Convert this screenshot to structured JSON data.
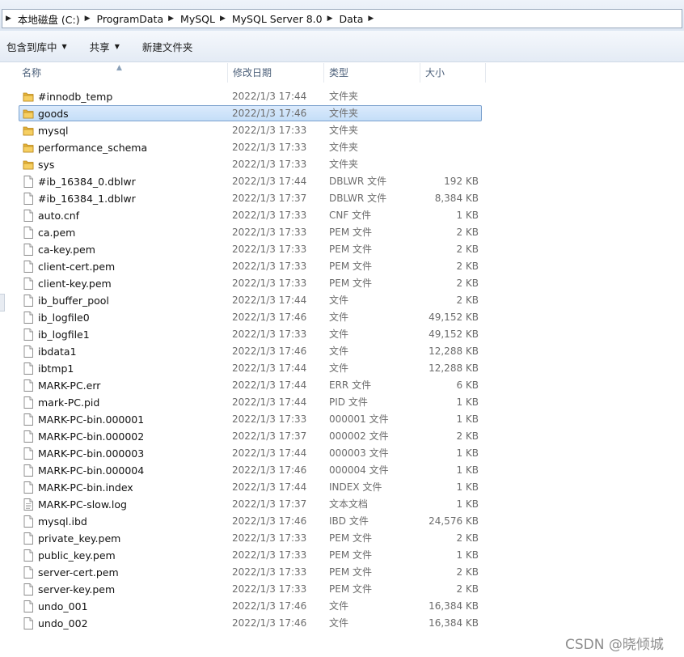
{
  "breadcrumb": [
    "本地磁盘 (C:)",
    "ProgramData",
    "MySQL",
    "MySQL Server 8.0",
    "Data"
  ],
  "toolbar": {
    "include_library": "包含到库中",
    "share": "共享",
    "new_folder": "新建文件夹"
  },
  "columns": {
    "name": "名称",
    "modified": "修改日期",
    "type": "类型",
    "size": "大小"
  },
  "rows": [
    {
      "name": "#innodb_temp",
      "date": "2022/1/3 17:44",
      "type": "文件夹",
      "size": "",
      "icon": "folder-icon"
    },
    {
      "name": "goods",
      "date": "2022/1/3 17:46",
      "type": "文件夹",
      "size": "",
      "icon": "folder-icon",
      "selected": true
    },
    {
      "name": "mysql",
      "date": "2022/1/3 17:33",
      "type": "文件夹",
      "size": "",
      "icon": "folder-icon"
    },
    {
      "name": "performance_schema",
      "date": "2022/1/3 17:33",
      "type": "文件夹",
      "size": "",
      "icon": "folder-icon"
    },
    {
      "name": "sys",
      "date": "2022/1/3 17:33",
      "type": "文件夹",
      "size": "",
      "icon": "folder-icon"
    },
    {
      "name": "#ib_16384_0.dblwr",
      "date": "2022/1/3 17:44",
      "type": "DBLWR 文件",
      "size": "192 KB",
      "icon": "file-icon"
    },
    {
      "name": "#ib_16384_1.dblwr",
      "date": "2022/1/3 17:37",
      "type": "DBLWR 文件",
      "size": "8,384 KB",
      "icon": "file-icon"
    },
    {
      "name": "auto.cnf",
      "date": "2022/1/3 17:33",
      "type": "CNF 文件",
      "size": "1 KB",
      "icon": "file-icon"
    },
    {
      "name": "ca.pem",
      "date": "2022/1/3 17:33",
      "type": "PEM 文件",
      "size": "2 KB",
      "icon": "file-icon"
    },
    {
      "name": "ca-key.pem",
      "date": "2022/1/3 17:33",
      "type": "PEM 文件",
      "size": "2 KB",
      "icon": "file-icon"
    },
    {
      "name": "client-cert.pem",
      "date": "2022/1/3 17:33",
      "type": "PEM 文件",
      "size": "2 KB",
      "icon": "file-icon"
    },
    {
      "name": "client-key.pem",
      "date": "2022/1/3 17:33",
      "type": "PEM 文件",
      "size": "2 KB",
      "icon": "file-icon"
    },
    {
      "name": "ib_buffer_pool",
      "date": "2022/1/3 17:44",
      "type": "文件",
      "size": "2 KB",
      "icon": "file-icon"
    },
    {
      "name": "ib_logfile0",
      "date": "2022/1/3 17:46",
      "type": "文件",
      "size": "49,152 KB",
      "icon": "file-icon"
    },
    {
      "name": "ib_logfile1",
      "date": "2022/1/3 17:33",
      "type": "文件",
      "size": "49,152 KB",
      "icon": "file-icon"
    },
    {
      "name": "ibdata1",
      "date": "2022/1/3 17:46",
      "type": "文件",
      "size": "12,288 KB",
      "icon": "file-icon"
    },
    {
      "name": "ibtmp1",
      "date": "2022/1/3 17:44",
      "type": "文件",
      "size": "12,288 KB",
      "icon": "file-icon"
    },
    {
      "name": "MARK-PC.err",
      "date": "2022/1/3 17:44",
      "type": "ERR 文件",
      "size": "6 KB",
      "icon": "file-icon"
    },
    {
      "name": "mark-PC.pid",
      "date": "2022/1/3 17:44",
      "type": "PID 文件",
      "size": "1 KB",
      "icon": "file-icon"
    },
    {
      "name": "MARK-PC-bin.000001",
      "date": "2022/1/3 17:33",
      "type": "000001 文件",
      "size": "1 KB",
      "icon": "file-icon"
    },
    {
      "name": "MARK-PC-bin.000002",
      "date": "2022/1/3 17:37",
      "type": "000002 文件",
      "size": "2 KB",
      "icon": "file-icon"
    },
    {
      "name": "MARK-PC-bin.000003",
      "date": "2022/1/3 17:44",
      "type": "000003 文件",
      "size": "1 KB",
      "icon": "file-icon"
    },
    {
      "name": "MARK-PC-bin.000004",
      "date": "2022/1/3 17:46",
      "type": "000004 文件",
      "size": "1 KB",
      "icon": "file-icon"
    },
    {
      "name": "MARK-PC-bin.index",
      "date": "2022/1/3 17:44",
      "type": "INDEX 文件",
      "size": "1 KB",
      "icon": "file-icon"
    },
    {
      "name": "MARK-PC-slow.log",
      "date": "2022/1/3 17:37",
      "type": "文本文档",
      "size": "1 KB",
      "icon": "text-file-icon"
    },
    {
      "name": "mysql.ibd",
      "date": "2022/1/3 17:46",
      "type": "IBD 文件",
      "size": "24,576 KB",
      "icon": "file-icon"
    },
    {
      "name": "private_key.pem",
      "date": "2022/1/3 17:33",
      "type": "PEM 文件",
      "size": "2 KB",
      "icon": "file-icon"
    },
    {
      "name": "public_key.pem",
      "date": "2022/1/3 17:33",
      "type": "PEM 文件",
      "size": "1 KB",
      "icon": "file-icon"
    },
    {
      "name": "server-cert.pem",
      "date": "2022/1/3 17:33",
      "type": "PEM 文件",
      "size": "2 KB",
      "icon": "file-icon"
    },
    {
      "name": "server-key.pem",
      "date": "2022/1/3 17:33",
      "type": "PEM 文件",
      "size": "2 KB",
      "icon": "file-icon"
    },
    {
      "name": "undo_001",
      "date": "2022/1/3 17:46",
      "type": "文件",
      "size": "16,384 KB",
      "icon": "file-icon"
    },
    {
      "name": "undo_002",
      "date": "2022/1/3 17:46",
      "type": "文件",
      "size": "16,384 KB",
      "icon": "file-icon"
    }
  ],
  "watermark": "CSDN @晓倾城",
  "colors": {
    "selection": "#cce4f7",
    "selection_border": "#7da2ce",
    "folder": "#e8b53a"
  }
}
